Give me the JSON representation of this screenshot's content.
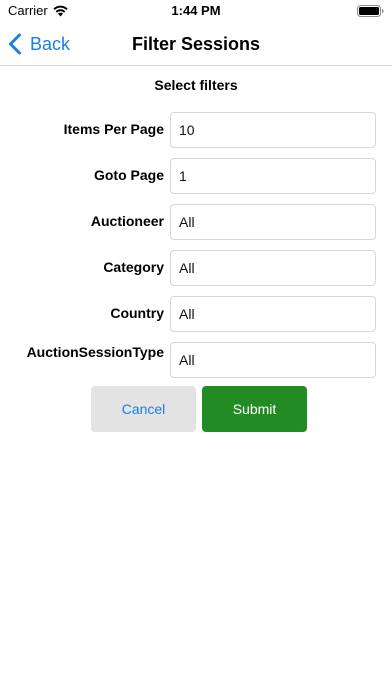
{
  "status_bar": {
    "carrier": "Carrier",
    "time": "1:44 PM"
  },
  "nav": {
    "back_label": "Back",
    "title": "Filter Sessions"
  },
  "form": {
    "section_title": "Select filters",
    "fields": [
      {
        "label": "Items Per Page",
        "value": "10"
      },
      {
        "label": "Goto Page",
        "value": "1"
      },
      {
        "label": "Auctioneer",
        "value": "All"
      },
      {
        "label": "Category",
        "value": "All"
      },
      {
        "label": "Country",
        "value": "All"
      },
      {
        "label": "AuctionSessionType",
        "value": "All"
      }
    ]
  },
  "buttons": {
    "cancel_label": "Cancel",
    "submit_label": "Submit"
  },
  "colors": {
    "accent": "#1a7fe0",
    "submit_bg": "#238b23",
    "cancel_bg": "#e3e3e3"
  }
}
